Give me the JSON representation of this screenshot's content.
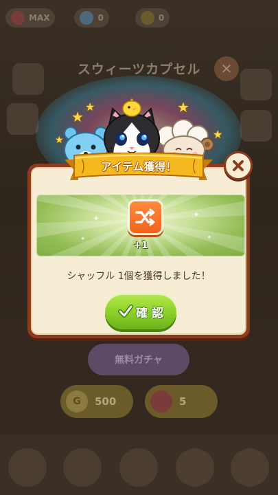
{
  "background": {
    "topbar": [
      {
        "label": "MAX",
        "color": "#6d5a44"
      },
      {
        "label": "0",
        "color": "#4d6a7d"
      },
      {
        "label": "0",
        "color": "#6b5a2a"
      }
    ],
    "title": "スウィーツカプセル",
    "gacha_button": "無料ガチャ",
    "gold_cost": "500",
    "gem_cost": "5"
  },
  "dialog": {
    "ribbon_title": "アイテム獲得！",
    "item_icon": "shuffle-icon",
    "item_count": "+1",
    "message": "シャッフル 1個を獲得しました！",
    "confirm_label": "確 認"
  },
  "colors": {
    "dialog_border": "#8c3b1e",
    "dialog_bg": "#f7ecd4",
    "ribbon": "#f2b11c",
    "confirm_green": "#8bcf28",
    "item_orange": "#f0641b"
  }
}
